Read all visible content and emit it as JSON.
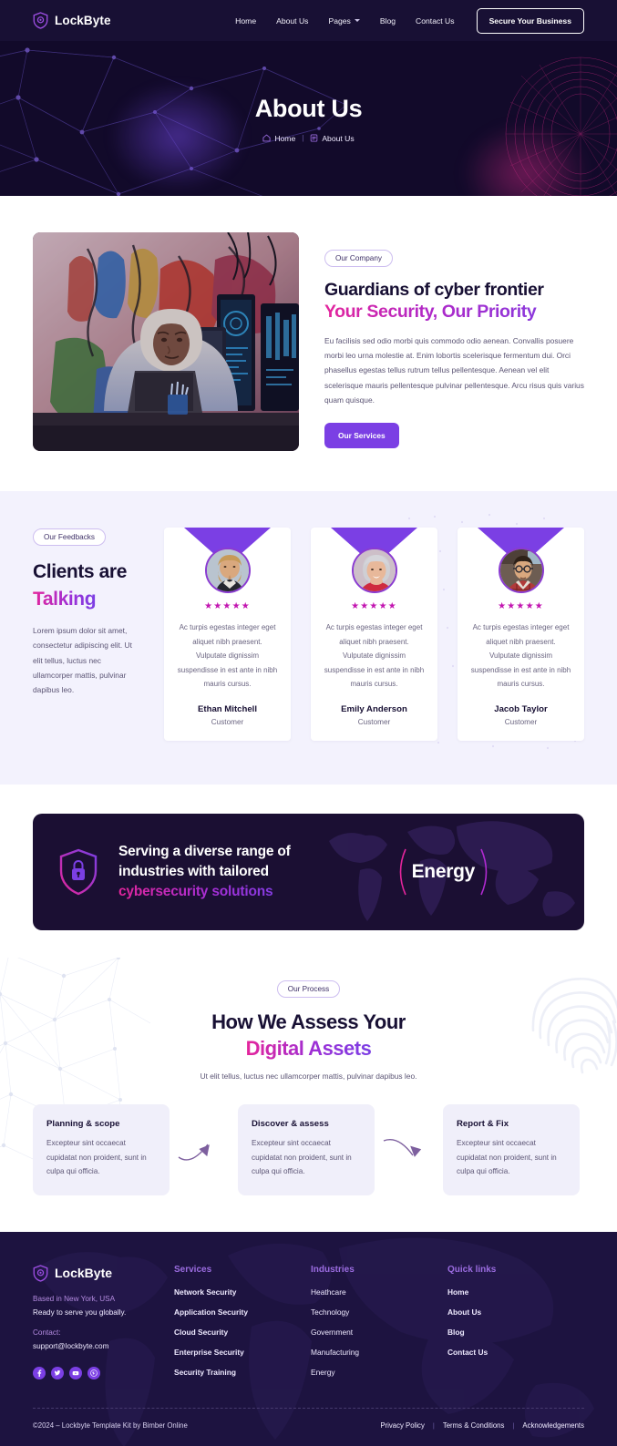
{
  "navbar": {
    "brand": "LockByte",
    "logo_icon": "shield-logo-icon",
    "links": [
      {
        "label": "Home",
        "name": "nav-link-home",
        "caret": false
      },
      {
        "label": "About Us",
        "name": "nav-link-about-us",
        "caret": false
      },
      {
        "label": "Pages",
        "name": "nav-link-pages",
        "caret": true
      },
      {
        "label": "Blog",
        "name": "nav-link-blog",
        "caret": false
      },
      {
        "label": "Contact Us",
        "name": "nav-link-contact-us",
        "caret": false
      }
    ],
    "cta_label": "Secure Your Business"
  },
  "page_header": {
    "title": "About Us",
    "breadcrumb": {
      "home_label": "Home",
      "home_icon": "home-icon",
      "separator": "|",
      "current_label": "About Us",
      "current_icon": "document-icon"
    }
  },
  "about": {
    "photo_alt": "hooded-person-at-computer-photo",
    "badge": "Our Company",
    "heading_line1": "Guardians of cyber frontier",
    "heading_line2": "Your Security, Our Priority",
    "paragraph": "Eu facilisis sed odio morbi quis commodo odio aenean. Convallis posuere morbi leo urna molestie at. Enim lobortis scelerisque fermentum dui. Orci phasellus egestas tellus rutrum tellus pellentesque. Aenean vel elit scelerisque mauris pellentesque pulvinar pellentesque. Arcu risus quis varius quam quisque.",
    "button_label": "Our Services"
  },
  "feedbacks": {
    "badge": "Our Feedbacks",
    "heading_plain": "Clients are",
    "heading_accent": "Talking",
    "paragraph": "Lorem ipsum dolor sit amet, consectetur adipiscing elit. Ut elit tellus, luctus nec ullamcorper mattis, pulvinar dapibus leo.",
    "stars": "★★★★★",
    "cards": [
      {
        "quote": "Ac turpis egestas integer eget aliquet nibh praesent. Vulputate dignissim suspendisse in est ante in nibh mauris cursus.",
        "name": "Ethan Mitchell",
        "role": "Customer",
        "avatar": "avatar-ethan-mitchell"
      },
      {
        "quote": "Ac turpis egestas integer eget aliquet nibh praesent. Vulputate dignissim suspendisse in est ante in nibh mauris cursus.",
        "name": "Emily Anderson",
        "role": "Customer",
        "avatar": "avatar-emily-anderson"
      },
      {
        "quote": "Ac turpis egestas integer eget aliquet nibh praesent. Vulputate dignissim suspendisse in est ante in nibh mauris cursus.",
        "name": "Jacob Taylor",
        "role": "Customer",
        "avatar": "avatar-jacob-taylor"
      }
    ]
  },
  "banner": {
    "icon": "shield-lock-icon",
    "line1": "Serving a diverse range of",
    "line2": "industries with tailored",
    "line3": "cybersecurity solutions",
    "rotating_word": "Energy"
  },
  "process": {
    "badge": "Our Process",
    "heading_plain": "How We Assess Your",
    "heading_accent": "Digital Assets",
    "subtitle": "Ut elit tellus, luctus nec ullamcorper mattis, pulvinar dapibus leo.",
    "steps": [
      {
        "title": "Planning & scope",
        "text": "Excepteur sint occaecat cupidatat non proident, sunt in culpa qui officia."
      },
      {
        "title": "Discover & assess",
        "text": "Excepteur sint occaecat cupidatat non proident, sunt in culpa qui officia."
      },
      {
        "title": "Report & Fix",
        "text": "Excepteur sint occaecat cupidatat non proident, sunt in culpa qui officia."
      }
    ]
  },
  "footer": {
    "brand": "LockByte",
    "location": "Based in New York, USA",
    "tagline": "Ready to serve you globally.",
    "contact_label": "Contact:",
    "email": "support@lockbyte.com",
    "socials": [
      {
        "name": "facebook-icon",
        "glyph": "f"
      },
      {
        "name": "twitter-icon",
        "glyph": "t"
      },
      {
        "name": "youtube-icon",
        "glyph": "y"
      },
      {
        "name": "pinterest-icon",
        "glyph": "p"
      }
    ],
    "columns": [
      {
        "head": "Services",
        "items": [
          "Network Security",
          "Application Security",
          "Cloud Security",
          "Enterprise Security",
          "Security Training"
        ]
      },
      {
        "head": "Industries",
        "items": [
          "Heathcare",
          "Technology",
          "Government",
          "Manufacturing",
          "Energy"
        ]
      },
      {
        "head": "Quick links",
        "items": [
          "Home",
          "About Us",
          "Blog",
          "Contact Us"
        ]
      }
    ],
    "copyright": "©2024 – Lockbyte Template Kit by Bimber Online",
    "legal": [
      "Privacy Policy",
      "Terms & Conditions",
      "Acknowledgements"
    ]
  },
  "colors": {
    "purple": "#7b3fe4",
    "magenta": "#e4259c",
    "dark": "#181034",
    "header_bg": "#120a2a",
    "footer_bg": "#1d1340",
    "light_lilac": "#f3f2fd"
  }
}
